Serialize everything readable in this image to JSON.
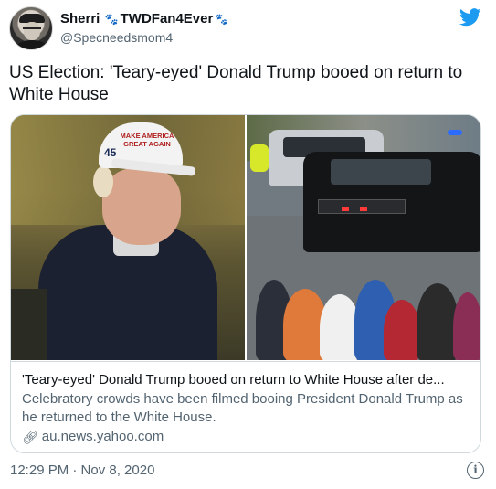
{
  "author": {
    "display_name": "Sherri",
    "fandom_label": "TWDFan4Ever",
    "handle": "@Specneedsmom4",
    "paw_icon": "paw-icon",
    "bird_icon": "twitter-bird-icon",
    "brand_color": "#1d9bf0"
  },
  "tweet": {
    "text": "US Election: 'Teary-eyed' Donald Trump booed on return to White House",
    "timestamp": "12:29 PM · Nov 8, 2020"
  },
  "card": {
    "image_left_cap_text": "MAKE AMERICA GREAT AGAIN",
    "image_left_cap_number": "45",
    "title": "'Teary-eyed' Donald Trump booed on return to White House after de...",
    "description": "Celebratory crowds have been filmed booing President Donald Trump as he returned to the White House.",
    "domain": "au.news.yahoo.com",
    "link_icon": "link-icon"
  },
  "info_icon": "info-icon"
}
